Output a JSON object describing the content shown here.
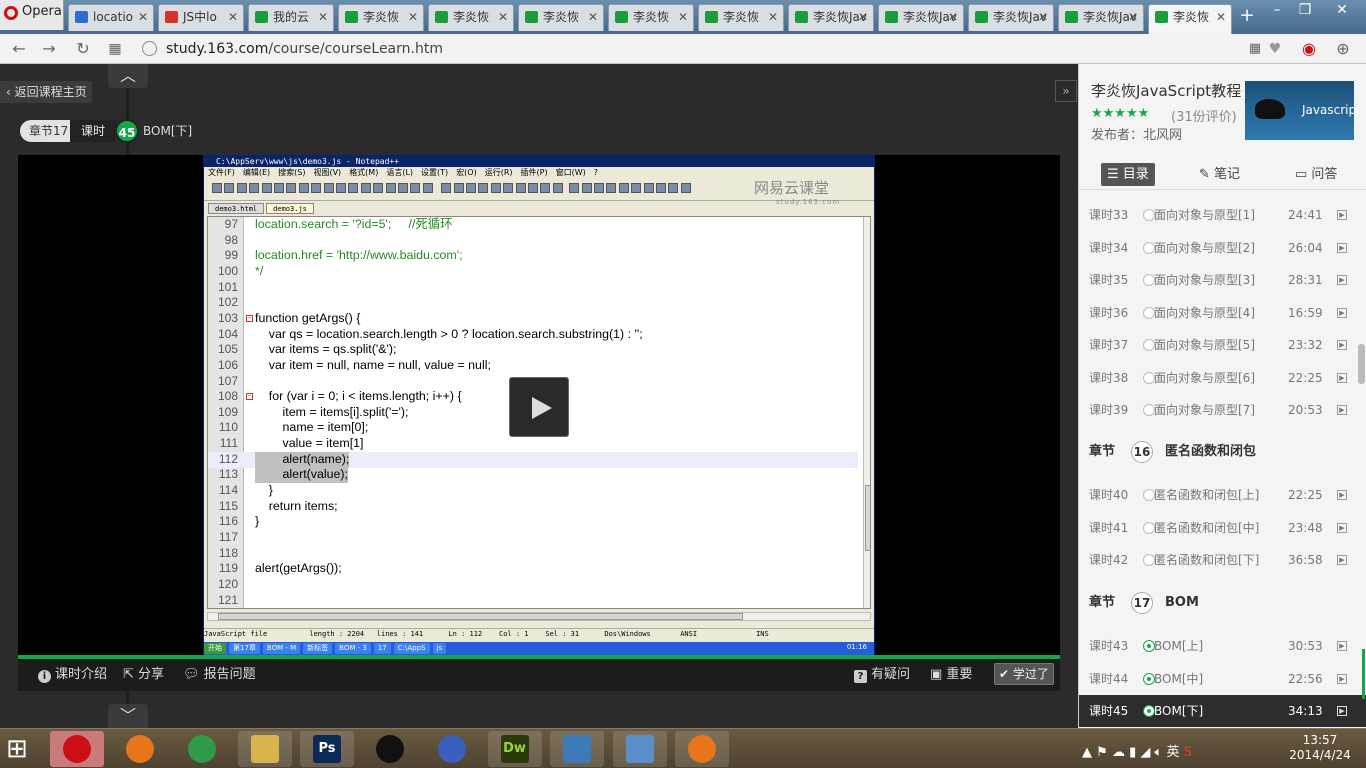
{
  "browser": {
    "menu_label": "Opera",
    "tabs": [
      {
        "label": "locatio",
        "icon": "paw-icon",
        "color": "blue"
      },
      {
        "label": "JS中lo",
        "icon": "weibo-icon",
        "color": "red"
      },
      {
        "label": "我的云",
        "icon": "book-icon",
        "color": "green"
      },
      {
        "label": "李炎恢",
        "icon": "book-icon",
        "color": "green"
      },
      {
        "label": "李炎恢",
        "icon": "book-icon",
        "color": "green"
      },
      {
        "label": "李炎恢",
        "icon": "book-icon",
        "color": "green"
      },
      {
        "label": "李炎恢",
        "icon": "book-icon",
        "color": "green"
      },
      {
        "label": "李炎恢",
        "icon": "book-icon",
        "color": "green"
      },
      {
        "label": "李炎恢Jav",
        "icon": "book-icon",
        "color": "green"
      },
      {
        "label": "李炎恢Jav",
        "icon": "book-icon",
        "color": "green"
      },
      {
        "label": "李炎恢Jav",
        "icon": "book-icon",
        "color": "green"
      },
      {
        "label": "李炎恢Jav",
        "icon": "book-icon",
        "color": "green"
      },
      {
        "label": "李炎恢",
        "icon": "book-icon",
        "color": "green",
        "active": true
      }
    ],
    "url_host": "study.163.com",
    "url_path": "/course/courseLearn.htm"
  },
  "player": {
    "back_label": "返回课程主页",
    "chapter_label": "章节17",
    "lesson_label": "课时",
    "lesson_number": "45",
    "lesson_title": "BOM[下]",
    "progress": 1.0,
    "controls": {
      "intro": "课时介绍",
      "share": "分享",
      "report": "报告问题",
      "question": "有疑问",
      "important": "重要",
      "learned": "学过了"
    }
  },
  "notepad": {
    "title": "C:\\AppServ\\www\\js\\demo3.js - Notepad++",
    "menu": [
      "文件(F)",
      "编辑(E)",
      "搜索(S)",
      "视图(V)",
      "格式(M)",
      "语言(L)",
      "设置(T)",
      "宏(O)",
      "运行(R)",
      "插件(P)",
      "窗口(W)",
      "?"
    ],
    "toolbar_brand": "网易云课堂",
    "toolbar_brand_sub": "study.163.com",
    "tabs": [
      "demo3.html",
      "demo3.js"
    ],
    "status": "JavaScript file          length : 2204   lines : 141      Ln : 112    Col : 1    Sel : 31      Dos\\Windows       ANSI              INS",
    "taskbar_items": [
      "开始",
      "第17章",
      "BOM - M",
      "新标签",
      "BOM - 3",
      "17",
      "C:\\AppS",
      "js"
    ],
    "taskbar_time": "01:16",
    "lines": [
      {
        "n": "97",
        "t": "location.search = '?id=5';     //死循环"
      },
      {
        "n": "98",
        "t": ""
      },
      {
        "n": "99",
        "t": "location.href = 'http://www.baidu.com';"
      },
      {
        "n": "100",
        "t": "*/"
      },
      {
        "n": "101",
        "t": ""
      },
      {
        "n": "102",
        "t": ""
      },
      {
        "n": "103",
        "t": "function getArgs() {"
      },
      {
        "n": "104",
        "t": "    var qs = location.search.length > 0 ? location.search.substring(1) : '';"
      },
      {
        "n": "105",
        "t": "    var items = qs.split('&');"
      },
      {
        "n": "106",
        "t": "    var item = null, name = null, value = null;"
      },
      {
        "n": "107",
        "t": ""
      },
      {
        "n": "108",
        "t": "    for (var i = 0; i < items.length; i++) {"
      },
      {
        "n": "109",
        "t": "        item = items[i].split('=');"
      },
      {
        "n": "110",
        "t": "        name = item[0];"
      },
      {
        "n": "111",
        "t": "        value = item[1]"
      },
      {
        "n": "112",
        "t": "        alert(name);"
      },
      {
        "n": "113",
        "t": "        alert(value);"
      },
      {
        "n": "114",
        "t": "    }"
      },
      {
        "n": "115",
        "t": "    return items;"
      },
      {
        "n": "116",
        "t": "}"
      },
      {
        "n": "117",
        "t": ""
      },
      {
        "n": "118",
        "t": ""
      },
      {
        "n": "119",
        "t": "alert(getArgs());"
      },
      {
        "n": "120",
        "t": ""
      },
      {
        "n": "121",
        "t": ""
      }
    ]
  },
  "course": {
    "title": "李炎恢JavaScript教程 ...",
    "stars": "★★★★★",
    "rating": "(31份评价)",
    "publisher": "发布者：北风网",
    "cover_label": "Javascript",
    "tabs": [
      "目录",
      "笔记",
      "问答"
    ]
  },
  "lessons": [
    {
      "no": "课时33",
      "title": "面向对象与原型[1]",
      "dur": "24:41"
    },
    {
      "no": "课时34",
      "title": "面向对象与原型[2]",
      "dur": "26:04"
    },
    {
      "no": "课时35",
      "title": "面向对象与原型[3]",
      "dur": "28:31"
    },
    {
      "no": "课时36",
      "title": "面向对象与原型[4]",
      "dur": "16:59"
    },
    {
      "no": "课时37",
      "title": "面向对象与原型[5]",
      "dur": "23:32"
    },
    {
      "no": "课时38",
      "title": "面向对象与原型[6]",
      "dur": "22:25"
    },
    {
      "no": "课时39",
      "title": "面向对象与原型[7]",
      "dur": "20:53"
    }
  ],
  "chapter16": {
    "label": "章节",
    "num": "16",
    "title": "匿名函数和闭包"
  },
  "lessons16": [
    {
      "no": "课时40",
      "title": "匿名函数和闭包[上]",
      "dur": "22:25"
    },
    {
      "no": "课时41",
      "title": "匿名函数和闭包[中]",
      "dur": "23:48"
    },
    {
      "no": "课时42",
      "title": "匿名函数和闭包[下]",
      "dur": "36:58"
    }
  ],
  "chapter17": {
    "label": "章节",
    "num": "17",
    "title": "BOM"
  },
  "lessons17": [
    {
      "no": "课时43",
      "title": "BOM[上]",
      "dur": "30:53"
    },
    {
      "no": "课时44",
      "title": "BOM[中]",
      "dur": "22:56"
    },
    {
      "no": "课时45",
      "title": "BOM[下]",
      "dur": "34:13"
    }
  ],
  "taskbar": {
    "apps": [
      "opera-icon",
      "firefox-icon",
      "chrome-icon",
      "explorer-icon",
      "photoshop-icon",
      "qq-icon",
      "infinity-icon",
      "dreamweaver-icon",
      "photos-icon",
      "notepad-icon",
      "firefox-icon"
    ],
    "ps_label": "Ps",
    "dw_label": "Dw",
    "ime_label": "英",
    "time": "13:57",
    "date": "2014/4/24"
  }
}
